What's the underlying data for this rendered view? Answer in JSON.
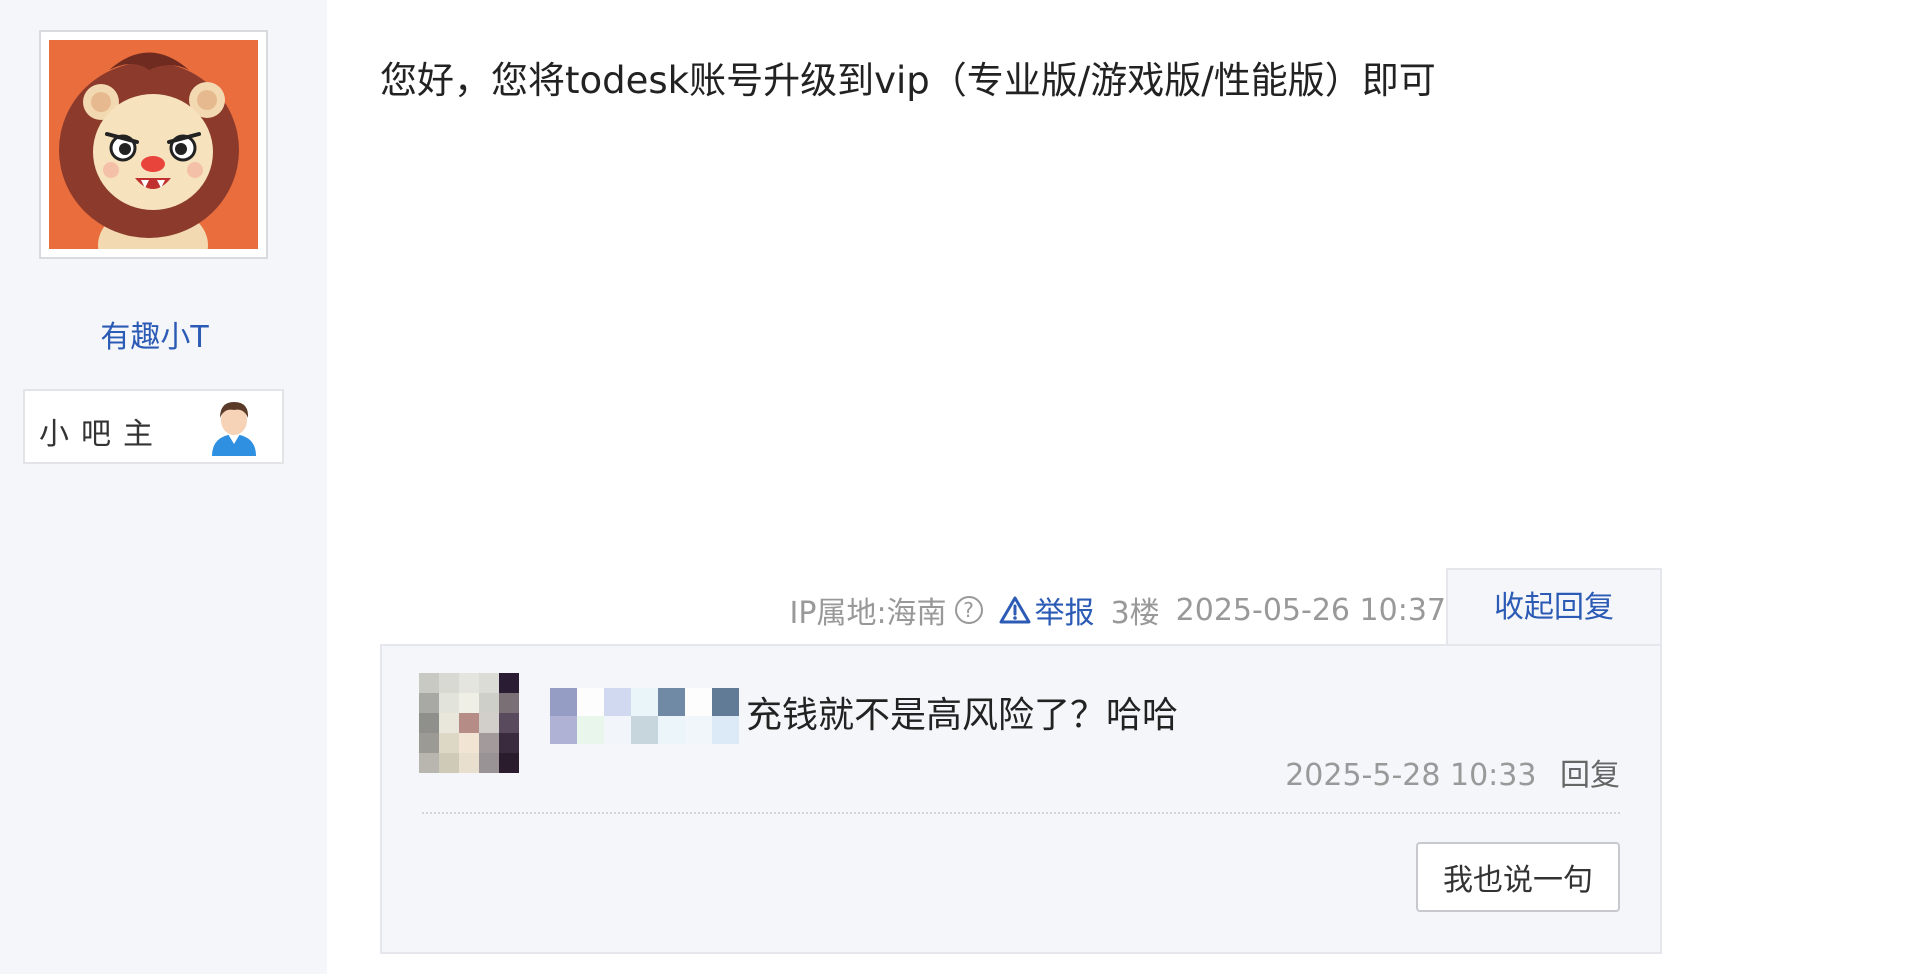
{
  "author": {
    "name": "有趣小T",
    "badge_label": "小吧主",
    "avatar_icon": "lion-mascot-avatar",
    "badge_icon": "user-person-icon"
  },
  "post": {
    "text": "您好，您将todesk账号升级到vip（专业版/游戏版/性能版）即可"
  },
  "meta": {
    "ip_location": "IP属地:海南",
    "help_symbol": "?",
    "report_label": "举报",
    "floor": "3楼",
    "time": "2025-05-26 10:37",
    "collapse_label": "收起回复"
  },
  "reply": {
    "text": "充钱就不是高风险了？哈哈",
    "time": "2025-5-28 10:33",
    "reply_label": "回复",
    "avatar_note": "pixelated avatar",
    "say_button_label": "我也说一句"
  },
  "colors": {
    "link_blue": "#2c5bb5",
    "muted_gray": "#999999",
    "panel_bg": "#f5f6fa",
    "avatar_bg": "#e96d3d"
  }
}
